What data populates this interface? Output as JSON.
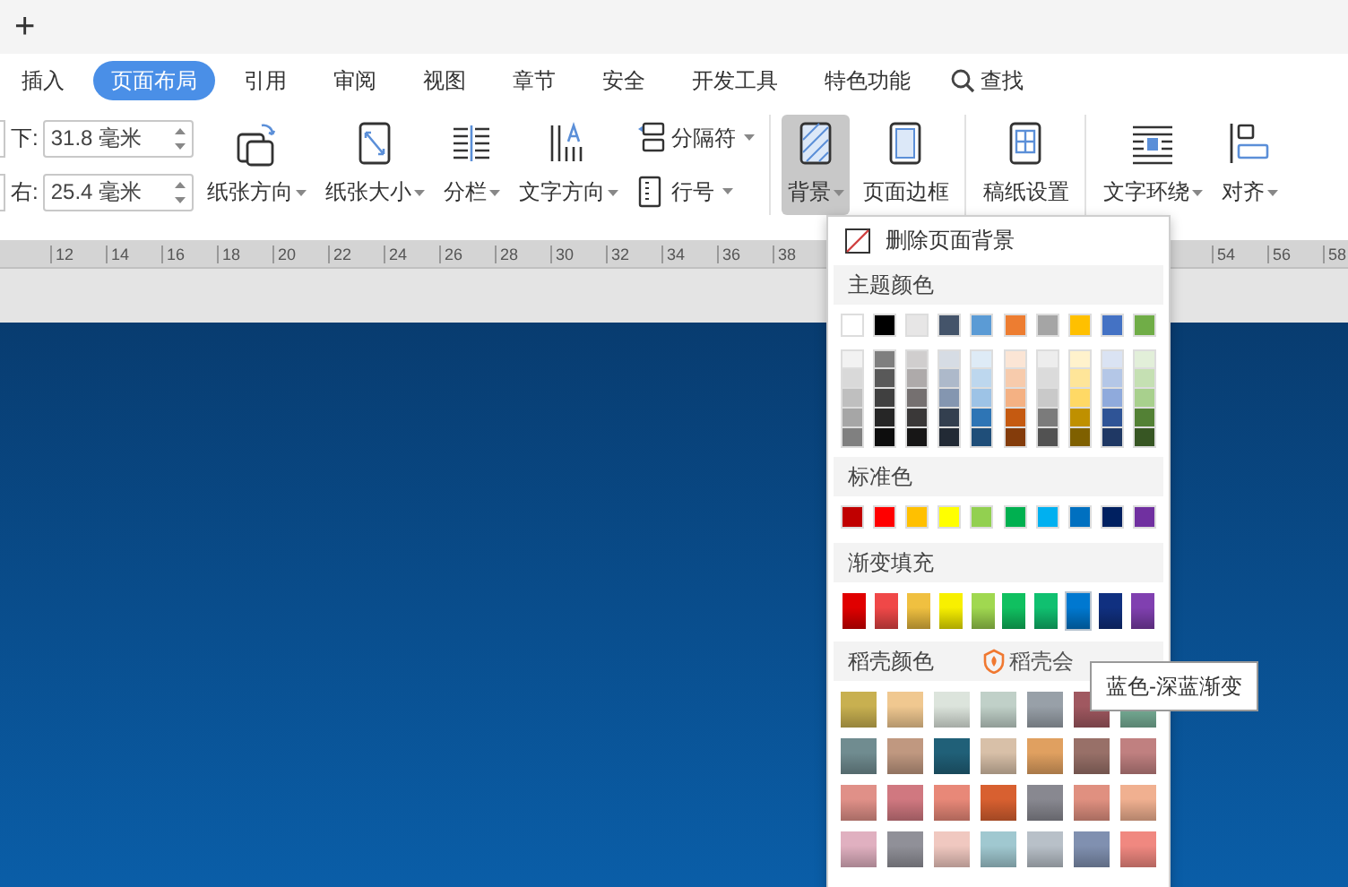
{
  "title_bar": {
    "new_tab": "+"
  },
  "ribbon_tabs": [
    {
      "label": "插入",
      "selected": false
    },
    {
      "label": "页面布局",
      "selected": true
    },
    {
      "label": "引用",
      "selected": false
    },
    {
      "label": "审阅",
      "selected": false
    },
    {
      "label": "视图",
      "selected": false
    },
    {
      "label": "章节",
      "selected": false
    },
    {
      "label": "安全",
      "selected": false
    },
    {
      "label": "开发工具",
      "selected": false
    },
    {
      "label": "特色功能",
      "selected": false
    }
  ],
  "search": {
    "label": "查找"
  },
  "toolbar_groups": [
    {
      "items": [
        {
          "kind": "field",
          "label": "下:",
          "value": "31.8 毫米"
        },
        {
          "kind": "field",
          "label": "右:",
          "value": "25.4 毫米"
        },
        {
          "kind": "large",
          "label": "纸张方向",
          "dropdown": true,
          "pressed": false
        },
        {
          "kind": "large",
          "label": "纸张大小",
          "dropdown": true,
          "pressed": false
        },
        {
          "kind": "large",
          "label": "分栏",
          "dropdown": true,
          "pressed": false
        },
        {
          "kind": "large",
          "label": "文字方向",
          "dropdown": true,
          "pressed": false
        },
        {
          "kind": "small",
          "label": "分隔符",
          "dropdown": true
        },
        {
          "kind": "small",
          "label": "行号",
          "dropdown": true
        }
      ]
    },
    {
      "items": [
        {
          "kind": "large",
          "label": "背景",
          "dropdown": true,
          "pressed": true
        },
        {
          "kind": "large",
          "label": "页面边框",
          "dropdown": false,
          "pressed": false
        }
      ]
    },
    {
      "items": [
        {
          "kind": "large",
          "label": "稿纸设置",
          "dropdown": false,
          "pressed": false
        }
      ]
    },
    {
      "items": [
        {
          "kind": "large",
          "label": "文字环绕",
          "dropdown": true,
          "pressed": false
        },
        {
          "kind": "large",
          "label": "对齐",
          "dropdown": true,
          "pressed": false
        }
      ]
    }
  ],
  "ruler": {
    "left_labels": [
      "12",
      "14",
      "16",
      "18",
      "20",
      "22",
      "24",
      "26",
      "28",
      "30",
      "32",
      "34",
      "36",
      "38"
    ],
    "right_labels": [
      "54",
      "56",
      "58"
    ]
  },
  "background_menu": {
    "remove": "删除页面背景",
    "theme_title": "主题颜色",
    "theme_colors": [
      {
        "color": "#ffffff"
      },
      {
        "color": "#000000"
      },
      {
        "color": "#e7e6e6"
      },
      {
        "color": "#44546a"
      },
      {
        "color": "#5b9bd5"
      },
      {
        "color": "#ed7d31"
      },
      {
        "color": "#a5a5a5"
      },
      {
        "color": "#ffc000"
      },
      {
        "color": "#4472c4"
      },
      {
        "color": "#70ad47"
      }
    ],
    "shade_rows": [
      [
        {
          "color": "#f2f2f2"
        },
        {
          "color": "#7f7f7f"
        },
        {
          "color": "#d0cece"
        },
        {
          "color": "#d6dce4"
        },
        {
          "color": "#deebf6"
        },
        {
          "color": "#fbe5d5"
        },
        {
          "color": "#ededed"
        },
        {
          "color": "#fff2cc"
        },
        {
          "color": "#dae3f3"
        },
        {
          "color": "#e2efd9"
        }
      ],
      [
        {
          "color": "#d9d9d9"
        },
        {
          "color": "#595959"
        },
        {
          "color": "#aeaaaa"
        },
        {
          "color": "#adb9ca"
        },
        {
          "color": "#bdd7ee"
        },
        {
          "color": "#f7cbac"
        },
        {
          "color": "#dbdbdb"
        },
        {
          "color": "#fee599"
        },
        {
          "color": "#b4c7e7"
        },
        {
          "color": "#c5e0b3"
        }
      ],
      [
        {
          "color": "#bfbfbf"
        },
        {
          "color": "#404040"
        },
        {
          "color": "#757070"
        },
        {
          "color": "#8496b0"
        },
        {
          "color": "#9dc3e6"
        },
        {
          "color": "#f4b183"
        },
        {
          "color": "#c9c9c9"
        },
        {
          "color": "#ffd965"
        },
        {
          "color": "#8faadc"
        },
        {
          "color": "#a8d08d"
        }
      ],
      [
        {
          "color": "#a6a6a6"
        },
        {
          "color": "#262626"
        },
        {
          "color": "#3a3838"
        },
        {
          "color": "#333f4f"
        },
        {
          "color": "#2e75b5"
        },
        {
          "color": "#c55a11"
        },
        {
          "color": "#7b7b7b"
        },
        {
          "color": "#bf9000"
        },
        {
          "color": "#2f5496"
        },
        {
          "color": "#538135"
        }
      ],
      [
        {
          "color": "#808080"
        },
        {
          "color": "#0d0d0d"
        },
        {
          "color": "#171616"
        },
        {
          "color": "#222a35"
        },
        {
          "color": "#1f4e79"
        },
        {
          "color": "#843c0b"
        },
        {
          "color": "#525252"
        },
        {
          "color": "#7f6000"
        },
        {
          "color": "#1f3864"
        },
        {
          "color": "#375623"
        }
      ]
    ],
    "standard_title": "标准色",
    "standard_colors": [
      {
        "color": "#c00000"
      },
      {
        "color": "#ff0000"
      },
      {
        "color": "#ffc000"
      },
      {
        "color": "#ffff00"
      },
      {
        "color": "#92d050"
      },
      {
        "color": "#00b050"
      },
      {
        "color": "#00b0f0"
      },
      {
        "color": "#0070c0"
      },
      {
        "color": "#002060"
      },
      {
        "color": "#7030a0"
      }
    ],
    "gradient_title": "渐变填充",
    "gradients": [
      {
        "color": "#e00000",
        "selected": false
      },
      {
        "color": "#f04848",
        "selected": false
      },
      {
        "color": "#f0c040",
        "selected": false
      },
      {
        "color": "#f8f000",
        "selected": false
      },
      {
        "color": "#a0d850",
        "selected": false
      },
      {
        "color": "#10c060",
        "selected": false
      },
      {
        "color": "#10c070",
        "selected": false
      },
      {
        "color": "#0078d0",
        "selected": true
      },
      {
        "color": "#103080",
        "selected": false
      },
      {
        "color": "#8040b0",
        "selected": false
      }
    ],
    "docer_title": "稻壳颜色",
    "docer_link": "稻壳会",
    "docer_rows": [
      [
        {
          "color": "#c8b050"
        },
        {
          "color": "#f0c890"
        },
        {
          "color": "#dce4dc"
        },
        {
          "color": "#c0d0c8"
        },
        {
          "color": "#98a0a8"
        },
        {
          "color": "#a05860"
        },
        {
          "color": "#78b098"
        }
      ],
      [
        {
          "color": "#708c90"
        },
        {
          "color": "#c09880"
        },
        {
          "color": "#206078"
        },
        {
          "color": "#d8c0a8"
        },
        {
          "color": "#e0a060"
        },
        {
          "color": "#987068"
        },
        {
          "color": "#c08080"
        }
      ],
      [
        {
          "color": "#e09088"
        },
        {
          "color": "#d07880"
        },
        {
          "color": "#e88878"
        },
        {
          "color": "#d86030"
        },
        {
          "color": "#888890"
        },
        {
          "color": "#e09080"
        },
        {
          "color": "#f0b090"
        }
      ],
      [
        {
          "color": "#e0b0c0"
        },
        {
          "color": "#909098"
        },
        {
          "color": "#f0c8c0"
        },
        {
          "color": "#a0c8d0"
        },
        {
          "color": "#b8c0c8"
        },
        {
          "color": "#8090b0"
        },
        {
          "color": "#f08880"
        }
      ]
    ]
  },
  "tooltip": "蓝色-深蓝渐变"
}
